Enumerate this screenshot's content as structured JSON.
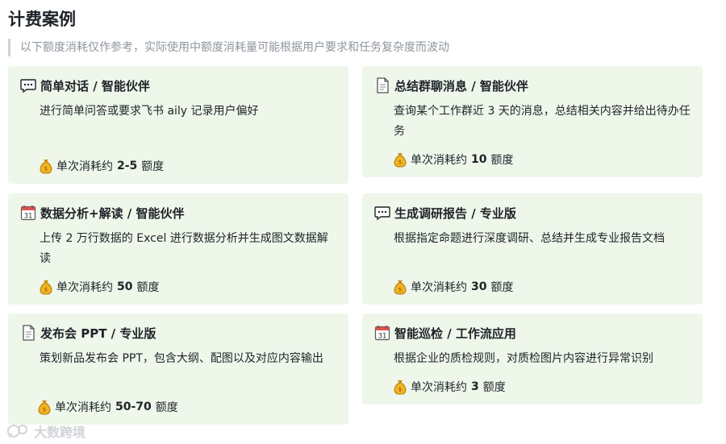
{
  "title": "计费案例",
  "subtitle": "以下额度消耗仅作参考，实际使用中额度消耗量可能根据用户要求和任务复杂度而波动",
  "cost_prefix": "单次消耗约",
  "cost_unit": "额度",
  "cards": [
    {
      "icon": "chat-bubble-icon",
      "title": "简单对话 / 智能伙伴",
      "desc": "进行简单问答或要求飞书 aily 记录用户偏好",
      "cost": "2-5"
    },
    {
      "icon": "document-icon",
      "title": "总结群聊消息 / 智能伙伴",
      "desc": "查询某个工作群近 3 天的消息，总结相关内容并给出待办任务",
      "cost": "10"
    },
    {
      "icon": "calendar-icon",
      "title": "数据分析+解读 / 智能伙伴",
      "desc": "上传 2 万行数据的 Excel 进行数据分析并生成图文数据解读",
      "cost": "50"
    },
    {
      "icon": "chat-bubble-icon",
      "title": "生成调研报告 / 专业版",
      "desc": "根据指定命题进行深度调研、总结并生成专业报告文档",
      "cost": "30"
    },
    {
      "icon": "document-icon",
      "title": "发布会 PPT / 专业版",
      "desc": "策划新品发布会 PPT，包含大纲、配图以及对应内容输出",
      "cost": "50-70"
    },
    {
      "icon": "calendar-icon",
      "title": "智能巡检 / 工作流应用",
      "desc": "根据企业的质检规则，对质检图片内容进行异常识别",
      "cost": "3"
    }
  ],
  "watermark": "大数跨境"
}
